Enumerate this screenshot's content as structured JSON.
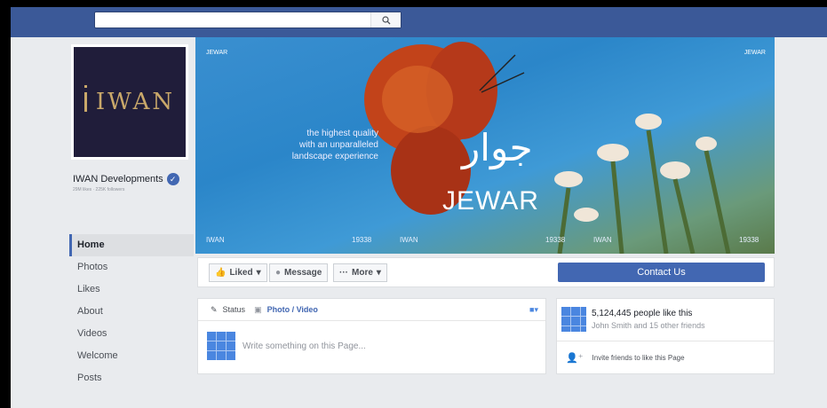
{
  "search": {
    "placeholder": ""
  },
  "profile": {
    "logo_text": "IWAN",
    "name": "IWAN Developments",
    "stats": "29M likes · 225K followers"
  },
  "nav": {
    "items": [
      {
        "label": "Home",
        "active": true
      },
      {
        "label": "Photos"
      },
      {
        "label": "Likes"
      },
      {
        "label": "About"
      },
      {
        "label": "Videos"
      },
      {
        "label": "Welcome"
      },
      {
        "label": "Posts"
      }
    ]
  },
  "cover": {
    "corner_left": "JEWAR",
    "corner_right": "JEWAR",
    "tagline_1": "the highest quality",
    "tagline_2": "with an unparalleled",
    "tagline_3": "landscape experience",
    "arabic": "جوار",
    "brand": "JEWAR",
    "footer_brand": "IWAN",
    "footer_phone": "19338"
  },
  "actions": {
    "liked": "Liked",
    "message": "Message",
    "more": "More",
    "contact": "Contact Us"
  },
  "composer": {
    "status": "Status",
    "photo_video": "Photo / Video",
    "placeholder": "Write something on this Page..."
  },
  "likes": {
    "count_text": "5,124,445 people like this",
    "friends_text": "John Smith and 15 other friends",
    "invite_text": "Invite friends to like this Page"
  },
  "colors": {
    "brand_blue": "#3b5998",
    "button_blue": "#4267b2",
    "logo_gold": "#c9a86a"
  }
}
